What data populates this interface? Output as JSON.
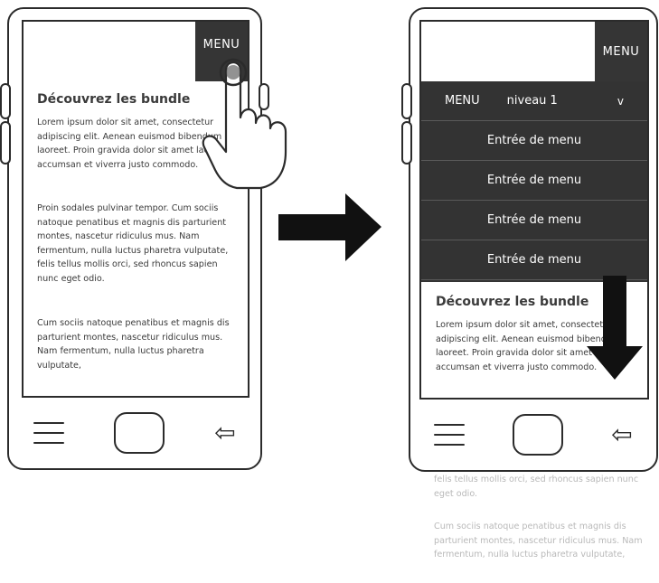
{
  "left_phone": {
    "menu_label": "MENU",
    "heading": "Découvrez les bundle",
    "paragraphs": [
      "Lorem ipsum dolor sit amet, consectetur adipiscing elit. Aenean euismod bibendum laoreet. Proin gravida dolor sit amet lacus accumsan et viverra justo commodo.",
      "Proin sodales pulvinar tempor. Cum sociis natoque penatibus et magnis dis parturient montes, nascetur ridiculus mus. Nam fermentum, nulla luctus pharetra vulputate, felis tellus mollis orci, sed rhoncus sapien nunc eget odio.",
      "Cum sociis natoque penatibus et magnis dis parturient montes, nascetur ridiculus mus. Nam fermentum, nulla luctus pharetra vulputate,"
    ]
  },
  "right_phone": {
    "menu_label": "MENU",
    "dropdown": {
      "header_menu": "MENU",
      "header_level": "niveau 1",
      "header_chevron": "v",
      "items": [
        "Entrée de menu",
        "Entrée de menu",
        "Entrée de menu",
        "Entrée de menu"
      ]
    },
    "heading": "Découvrez les bundle",
    "paragraph": "Lorem ipsum dolor sit amet, consectetur adipiscing elit. Aenean euismod bibendum laoreet. Proin gravida dolor sit amet lacus accumsan et viverra justo commodo."
  },
  "overflow": {
    "lines_1": "felis tellus mollis orci, sed rhoncus sapien nunc eget odio.",
    "lines_2": "Cum sociis natoque penatibus et magnis dis parturient montes, nascetur ridiculus mus. Nam fermentum, nulla luctus pharetra vulputate,"
  },
  "icons": {
    "nav_menu": "hamburger-icon",
    "nav_home": "home-button-icon",
    "nav_back": "back-arrow-icon",
    "pointer": "pointing-hand-icon",
    "transition": "right-arrow-icon",
    "scroll": "down-arrow-icon"
  },
  "back_glyph": "⇦"
}
